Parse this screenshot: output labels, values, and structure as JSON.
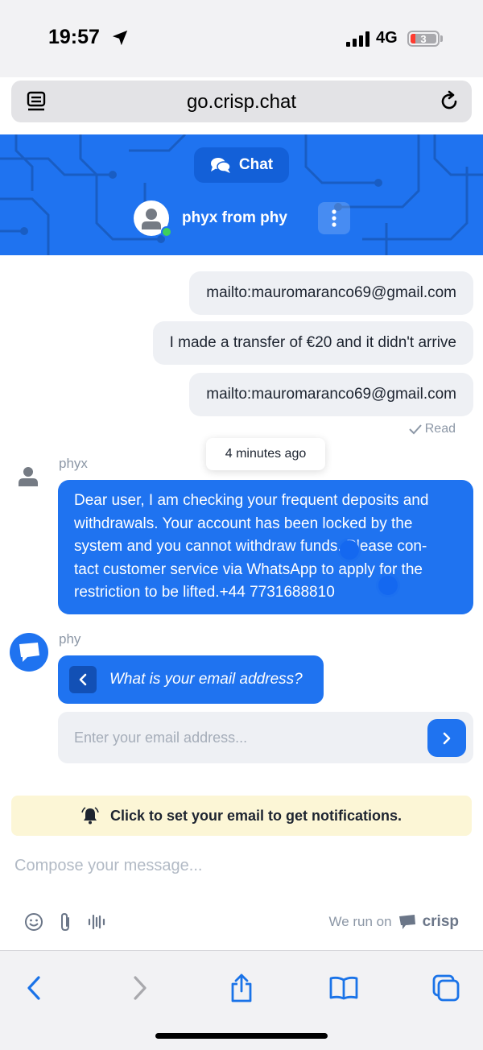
{
  "status_bar": {
    "time": "19:57",
    "network": "4G",
    "battery": "3"
  },
  "browser": {
    "url": "go.crisp.chat"
  },
  "chat_header": {
    "tab_label": "Chat",
    "operator_name": "phyx from phy"
  },
  "messages": {
    "user": [
      "mailto:mauromaranco69@gmail.com",
      "I made a transfer of €20 and it didn't arrive",
      "mailto:mauromaranco69@gmail.com"
    ],
    "read_status": "Read",
    "tooltip": "4 minutes ago",
    "agent_name": "phyx",
    "agent_lines": [
      "Dear user, I am checking your frequent deposits and",
      "withdrawals. Your account has been locked by the",
      "system and you cannot withdraw funds. Please con-",
      "tact customer service via WhatsApp to apply for the",
      "restriction to be lifted.+44 7731688810"
    ],
    "bot_name": "phy",
    "bot_question": "What is your email address?",
    "email_placeholder": "Enter your email address..."
  },
  "notification_banner": "Click to set your email to get notifications.",
  "composer": {
    "placeholder": "Compose your message...",
    "powered_label": "We run on",
    "powered_brand": "crisp"
  },
  "colors": {
    "accent": "#1f73f0",
    "banner": "#fcf6d6",
    "online": "#3ed05a"
  }
}
